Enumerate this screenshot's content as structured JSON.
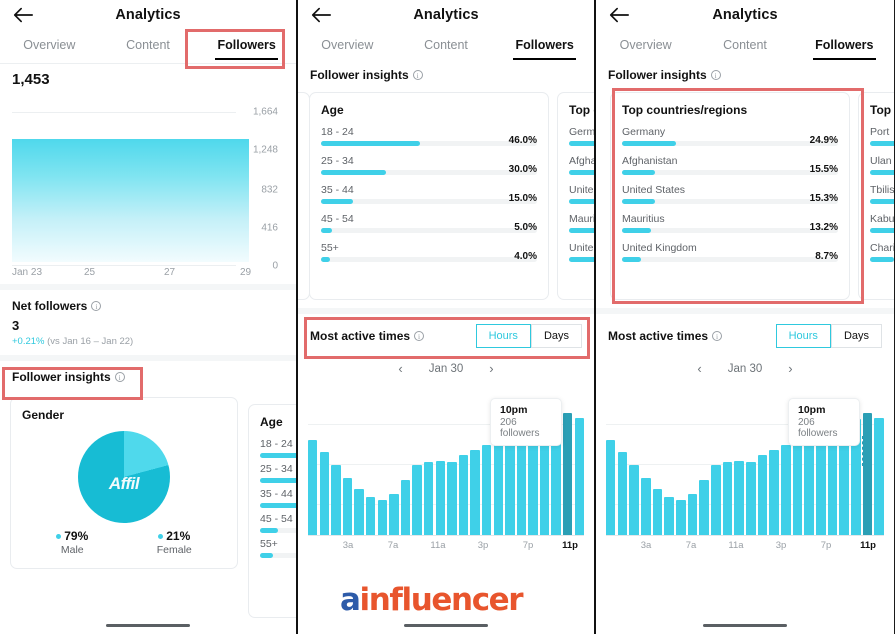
{
  "header": {
    "title": "Analytics",
    "back_icon": "back-arrow-icon"
  },
  "tabs": [
    {
      "label": "Overview",
      "active": false
    },
    {
      "label": "Content",
      "active": false
    },
    {
      "label": "Followers",
      "active": true
    }
  ],
  "panel1": {
    "total_followers": "1,453",
    "follower_chart": {
      "y_ticks": [
        "1,664",
        "1,248",
        "832",
        "416",
        "0"
      ],
      "x_ticks": [
        "Jan 23",
        "25",
        "27",
        "29"
      ]
    },
    "net_followers": {
      "title": "Net followers",
      "value": "3",
      "delta": "+0.21%",
      "compare": "(vs Jan 16 – Jan 22)"
    },
    "follower_insights_title": "Follower insights",
    "gender_card": {
      "title": "Gender",
      "watermark": "Affil",
      "male_pct": "79%",
      "male_label": "Male",
      "female_pct": "21%",
      "female_label": "Female"
    },
    "age_card_peek": {
      "title": "Age"
    }
  },
  "panel2": {
    "follower_insights_title": "Follower insights",
    "age_card": {
      "title": "Age",
      "rows": [
        {
          "label": "18 - 24",
          "pct": "46.0%"
        },
        {
          "label": "25 - 34",
          "pct": "30.0%"
        },
        {
          "label": "35 - 44",
          "pct": "15.0%"
        },
        {
          "label": "45 - 54",
          "pct": "5.0%"
        },
        {
          "label": "55+",
          "pct": "4.0%"
        }
      ]
    },
    "countries_card_peek": {
      "title": "Top c",
      "rows": [
        "Germ",
        "Afgha",
        "Unite",
        "Mauri",
        "Unite"
      ]
    },
    "most_active": {
      "title": "Most active times",
      "toggle": [
        {
          "label": "Hours",
          "active": true
        },
        {
          "label": "Days",
          "active": false
        }
      ],
      "date": "Jan 30",
      "prev_icon": "chevron-left-icon",
      "next_icon": "chevron-right-icon",
      "tooltip": {
        "time": "10pm",
        "followers": "206 followers"
      }
    },
    "watermark": {
      "prefix": "a",
      "rest": "influencer"
    }
  },
  "panel3": {
    "follower_insights_title": "Follower insights",
    "countries_card": {
      "title": "Top countries/regions",
      "rows": [
        {
          "label": "Germany",
          "pct": "24.9%"
        },
        {
          "label": "Afghanistan",
          "pct": "15.5%"
        },
        {
          "label": "United States",
          "pct": "15.3%"
        },
        {
          "label": "Mauritius",
          "pct": "13.2%"
        },
        {
          "label": "United Kingdom",
          "pct": "8.7%"
        }
      ]
    },
    "cities_card_peek": {
      "title": "Top c",
      "rows": [
        "Port ",
        "Ulan ",
        "Tbilis",
        "Kabu",
        "Chari"
      ]
    },
    "most_active": {
      "title": "Most active times",
      "toggle": [
        {
          "label": "Hours",
          "active": true
        },
        {
          "label": "Days",
          "active": false
        }
      ],
      "date": "Jan 30",
      "prev_icon": "chevron-left-icon",
      "next_icon": "chevron-right-icon",
      "tooltip": {
        "time": "10pm",
        "followers": "206 followers"
      }
    }
  },
  "colors": {
    "accent": "#3fd0e8",
    "accent_dark": "#2b9fb5",
    "annotation": "#e26b6b",
    "muted": "#9aa0a6"
  },
  "chart_data": [
    {
      "type": "area",
      "title": "Followers over time",
      "xlabel": "",
      "ylabel": "",
      "x": [
        "Jan 23",
        "Jan 24",
        "Jan 25",
        "Jan 26",
        "Jan 27",
        "Jan 28",
        "Jan 29"
      ],
      "values": [
        1450,
        1450,
        1451,
        1451,
        1452,
        1452,
        1453
      ],
      "ylim": [
        0,
        1664
      ],
      "y_ticks": [
        0,
        416,
        832,
        1248,
        1664
      ],
      "x_ticks": [
        "Jan 23",
        "25",
        "27",
        "29"
      ],
      "grid": true
    },
    {
      "type": "pie",
      "title": "Gender",
      "labels": [
        "Male",
        "Female"
      ],
      "values": [
        79,
        21
      ],
      "legend": "bottom"
    },
    {
      "type": "bar",
      "title": "Age",
      "orientation": "horizontal",
      "categories": [
        "18 - 24",
        "25 - 34",
        "35 - 44",
        "45 - 54",
        "55+"
      ],
      "values": [
        46.0,
        30.0,
        15.0,
        5.0,
        4.0
      ],
      "xlabel": "",
      "ylabel": "",
      "xlim": [
        0,
        100
      ]
    },
    {
      "type": "bar",
      "title": "Top countries/regions",
      "orientation": "horizontal",
      "categories": [
        "Germany",
        "Afghanistan",
        "United States",
        "Mauritius",
        "United Kingdom"
      ],
      "values": [
        24.9,
        15.5,
        15.3,
        13.2,
        8.7
      ],
      "xlabel": "",
      "ylabel": "",
      "xlim": [
        0,
        100
      ]
    },
    {
      "type": "bar",
      "title": "Most active times",
      "subtitle": "Jan 30",
      "categories": [
        "12a",
        "1a",
        "2a",
        "3a",
        "4a",
        "5a",
        "6a",
        "7a",
        "8a",
        "9a",
        "10a",
        "11a",
        "12p",
        "1p",
        "2p",
        "3p",
        "4p",
        "5p",
        "6p",
        "7p",
        "8p",
        "9p",
        "10p",
        "11p"
      ],
      "values": [
        160,
        140,
        118,
        97,
        78,
        64,
        61,
        70,
        92,
        118,
        124,
        126,
        124,
        134,
        142,
        152,
        160,
        163,
        163,
        180,
        188,
        194,
        206,
        196
      ],
      "highlight_index": 22,
      "annotation": "10pm — 206 followers",
      "xlabel": "",
      "ylabel": "",
      "ylim": [
        0,
        220
      ],
      "x_ticks": [
        "3a",
        "7a",
        "11a",
        "3p",
        "7p",
        "11p"
      ]
    }
  ]
}
